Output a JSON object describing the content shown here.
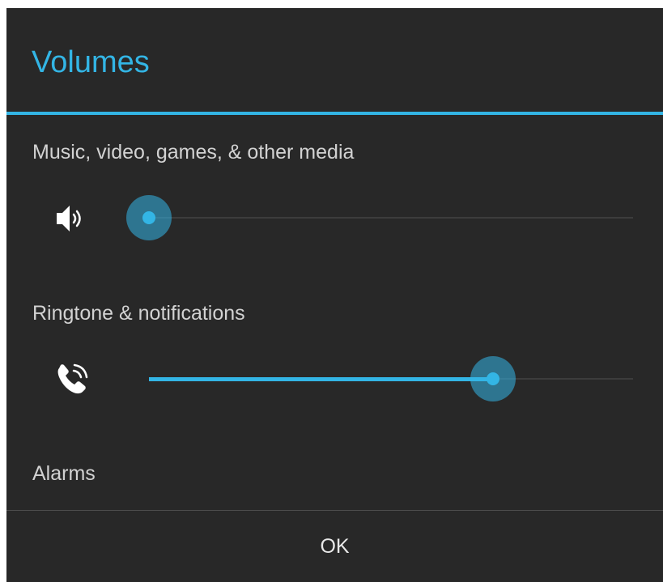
{
  "dialog": {
    "title": "Volumes",
    "ok_label": "OK"
  },
  "colors": {
    "accent": "#33b5e5",
    "background": "#282828",
    "label_text": "#d2d2d2"
  },
  "sections": {
    "media": {
      "label": "Music, video, games, & other media",
      "icon": "speaker-volume-icon",
      "level_fraction": 0.0
    },
    "ringtone": {
      "label": "Ringtone & notifications",
      "icon": "ringing-phone-icon",
      "level_fraction": 0.71
    },
    "alarms": {
      "label": "Alarms"
    }
  }
}
